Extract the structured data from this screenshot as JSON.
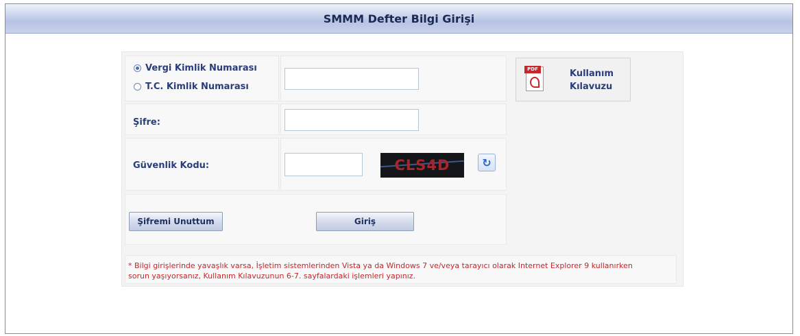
{
  "window": {
    "title": "SMMM Defter Bilgi Girişi"
  },
  "login_type": {
    "options": [
      {
        "label": "Vergi Kimlik Numarası",
        "checked": true
      },
      {
        "label": "T.C. Kimlik Numarası",
        "checked": false
      }
    ],
    "id_value": ""
  },
  "password": {
    "label": "Şifre:",
    "value": ""
  },
  "captcha": {
    "label": "Güvenlik Kodu:",
    "value": "",
    "code": "CLS4D",
    "refresh_icon": "refresh-icon"
  },
  "guide": {
    "line1": "Kullanım",
    "line2": "Kılavuzu",
    "icon": "pdf-icon",
    "icon_tag": "PDF"
  },
  "buttons": {
    "forgot": "Şifremi Unuttum",
    "login": "Giriş"
  },
  "notice": "* Bilgi girişlerinde yavaşlık varsa, İşletim sistemlerinden Vista ya da Windows 7 ve/veya tarayıcı olarak Internet Explorer 9 kullanırken sorun yaşıyorsanız, Kullanım Kılavuzunun 6-7. sayfalardaki işlemleri yapınız.",
  "colors": {
    "accent": "#2a3d7a",
    "warning": "#c1272d",
    "title_bar": "#b6c3e3"
  }
}
